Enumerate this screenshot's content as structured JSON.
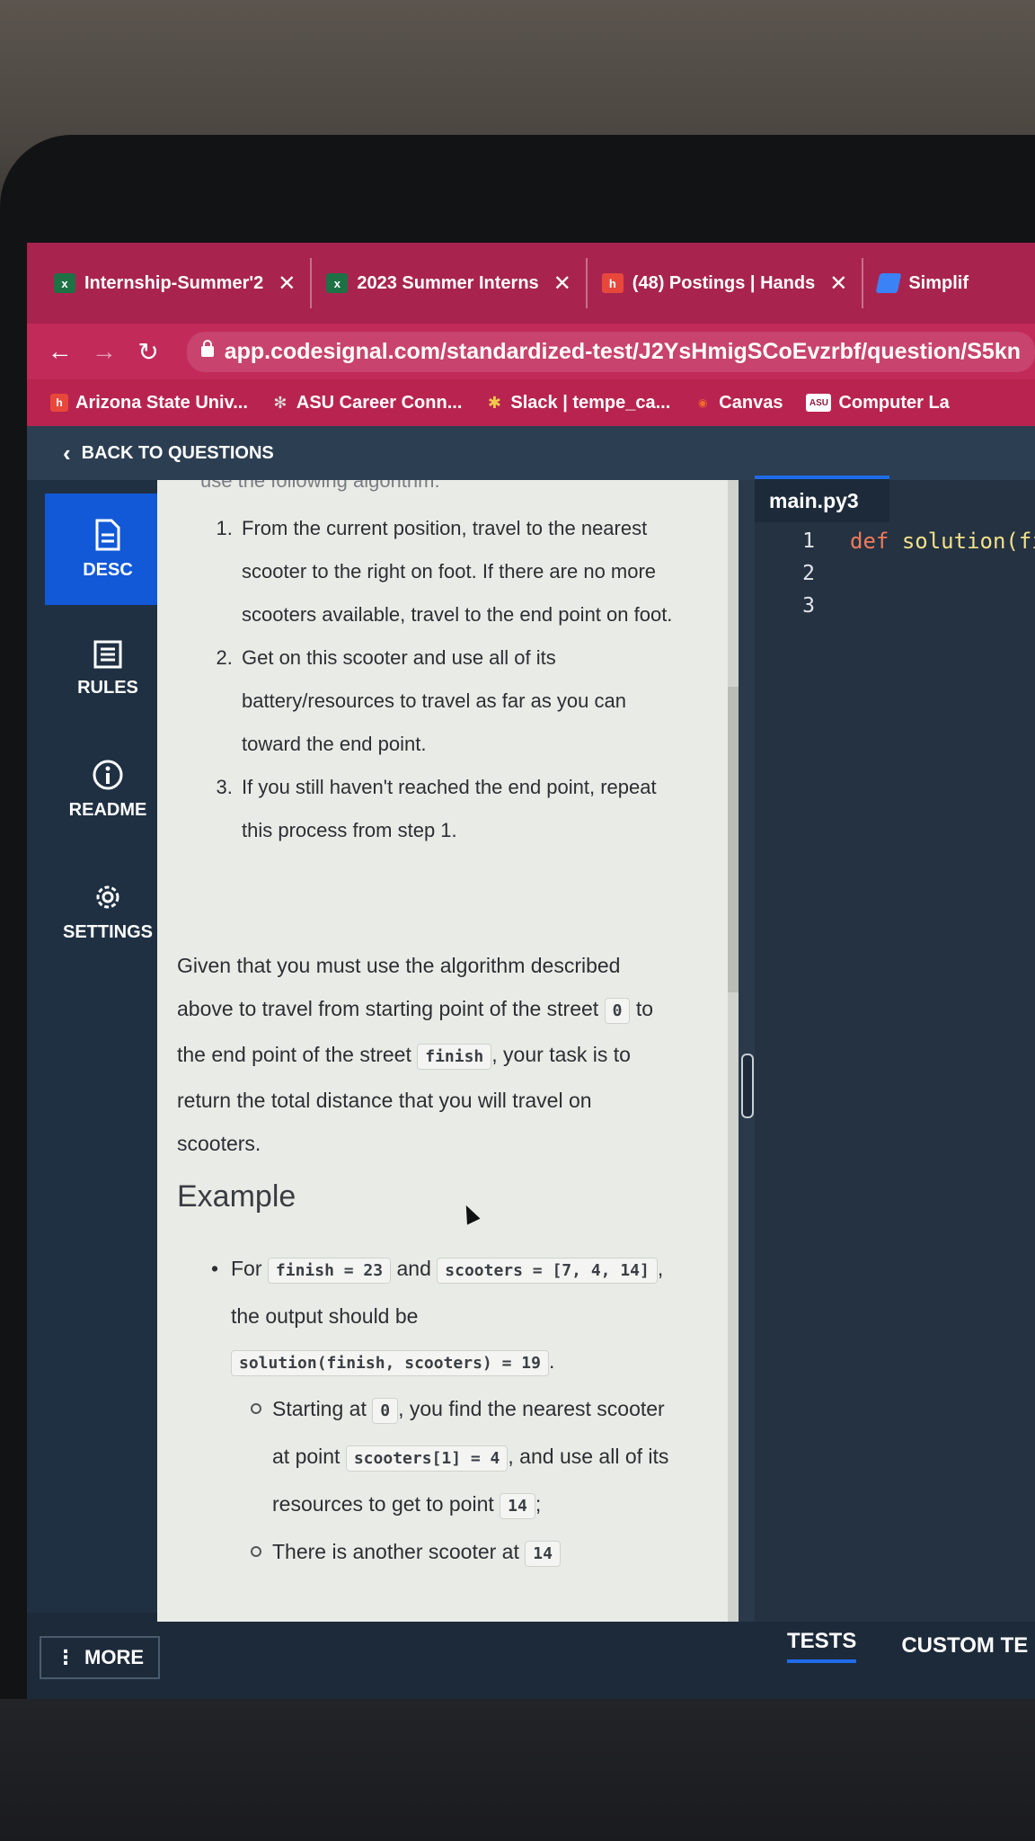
{
  "tabs": [
    {
      "icon": "excel-icon",
      "label": "Internship-Summer'2"
    },
    {
      "icon": "excel-icon",
      "label": "2023 Summer Interns"
    },
    {
      "icon": "handshake-icon",
      "label": "(48) Postings | Hands"
    },
    {
      "icon": "simplify-icon",
      "label": "Simplif"
    }
  ],
  "address": {
    "url": "app.codesignal.com/standardized-test/J2YsHmigSCoEvzrbf/question/S5kn"
  },
  "bookmarks": [
    {
      "icon": "handshake-icon",
      "label": "Arizona State Univ..."
    },
    {
      "icon": "gear-icon",
      "label": "ASU Career Conn..."
    },
    {
      "icon": "slack-icon",
      "label": "Slack | tempe_ca..."
    },
    {
      "icon": "canvas-icon",
      "label": "Canvas"
    },
    {
      "icon": "asu-icon",
      "label": "Computer La"
    }
  ],
  "app": {
    "back_label": "BACK TO QUESTIONS"
  },
  "sidebar": {
    "items": [
      {
        "label": "DESC",
        "icon": "document-icon"
      },
      {
        "label": "RULES",
        "icon": "list-icon"
      },
      {
        "label": "README",
        "icon": "info-icon"
      },
      {
        "label": "SETTINGS",
        "icon": "gear-icon"
      }
    ],
    "more_label": "MORE"
  },
  "desc": {
    "cutoff": "use the following algorithm:",
    "steps": [
      "From the current position, travel to the nearest scooter to the right on foot. If there are no more scooters available, travel to the end point on foot.",
      "Get on this scooter and use all of its battery/resources to travel as far as you can toward the end point.",
      "If you still haven't reached the end point, repeat this process from step 1."
    ],
    "para": {
      "t1": "Given that you must use the algorithm described above to travel from starting point of the street",
      "c1": "0",
      "t2": "to the end point of the street",
      "c2": "finish",
      "t3": ", your task is to return the total distance that you will travel on scooters."
    },
    "example_heading": "Example",
    "example": {
      "t1": "For",
      "c1": "finish = 23",
      "t2": "and",
      "c2": "scooters = [7, 4, 14]",
      "t3": ", the output should be",
      "c3": "solution(finish, scooters) = 19",
      "t4": ".",
      "sub1": {
        "t1": "Starting at",
        "c1": "0",
        "t2": ", you find the nearest scooter at point",
        "c2": "scooters[1] = 4",
        "t3": ", and use all of its resources to get to point",
        "c3": "14",
        "t4": ";"
      },
      "sub2": {
        "t1": "There is another scooter at",
        "c1": "14"
      }
    }
  },
  "editor": {
    "tab": "main.py3",
    "line_numbers": [
      "1",
      "2",
      "3"
    ],
    "code": {
      "kw": "def",
      "rest": "solution(fin"
    }
  },
  "tests_tabs": [
    "TESTS",
    "CUSTOM TE"
  ]
}
